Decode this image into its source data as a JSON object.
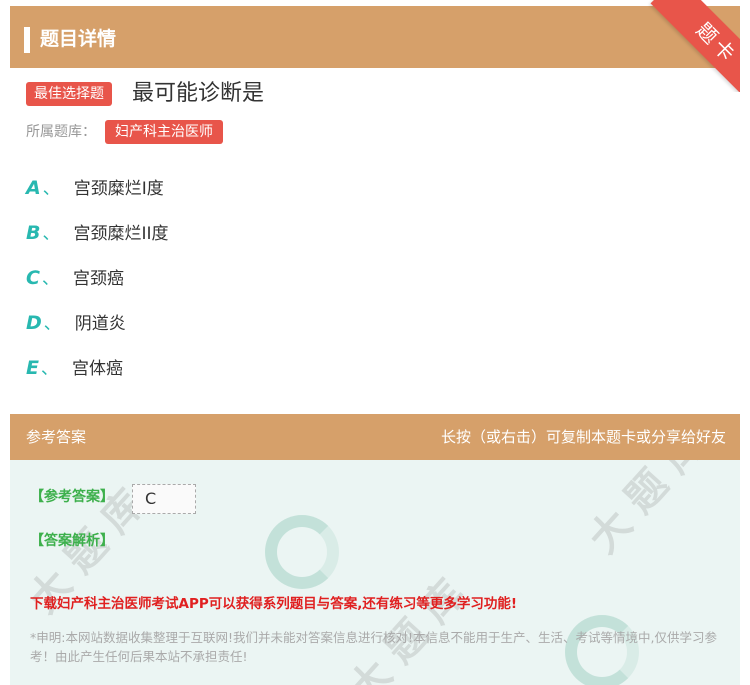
{
  "header": {
    "title": "题目详情"
  },
  "ribbon": {
    "label": "题卡"
  },
  "question": {
    "type_badge": "最佳选择题",
    "stem": "最可能诊断是",
    "bank_label": "所属题库：",
    "bank_name": "妇产科主治医师",
    "options": [
      {
        "letter": "A",
        "sep": "、",
        "text": "宫颈糜烂I度"
      },
      {
        "letter": "B",
        "sep": "、",
        "text": "宫颈糜烂II度"
      },
      {
        "letter": "C",
        "sep": "、",
        "text": "宫颈癌"
      },
      {
        "letter": "D",
        "sep": "、",
        "text": "阴道炎"
      },
      {
        "letter": "E",
        "sep": "、",
        "text": "宫体癌"
      }
    ]
  },
  "answer_section": {
    "title": "参考答案",
    "hint": "长按（或右击）可复制本题卡或分享给好友",
    "answer_label": "【参考答案】",
    "answer_value": "C",
    "analysis_label": "【答案解析】",
    "promo": "下载妇产科主治医师考试APP可以获得系列题目与答案,还有练习等更多学习功能!",
    "disclaimer": "*申明:本网站数据收集整理于互联网!我们并未能对答案信息进行核对!本信息不能用于生产、生活、考试等情境中,仅供学习参考！由此产生任何后果本站不承担责任!"
  },
  "colors": {
    "accent_tan": "#d6a06a",
    "badge_red": "#e8554a",
    "option_teal": "#28b8b0",
    "answer_green": "#3db04c",
    "promo_red": "#e02020"
  }
}
